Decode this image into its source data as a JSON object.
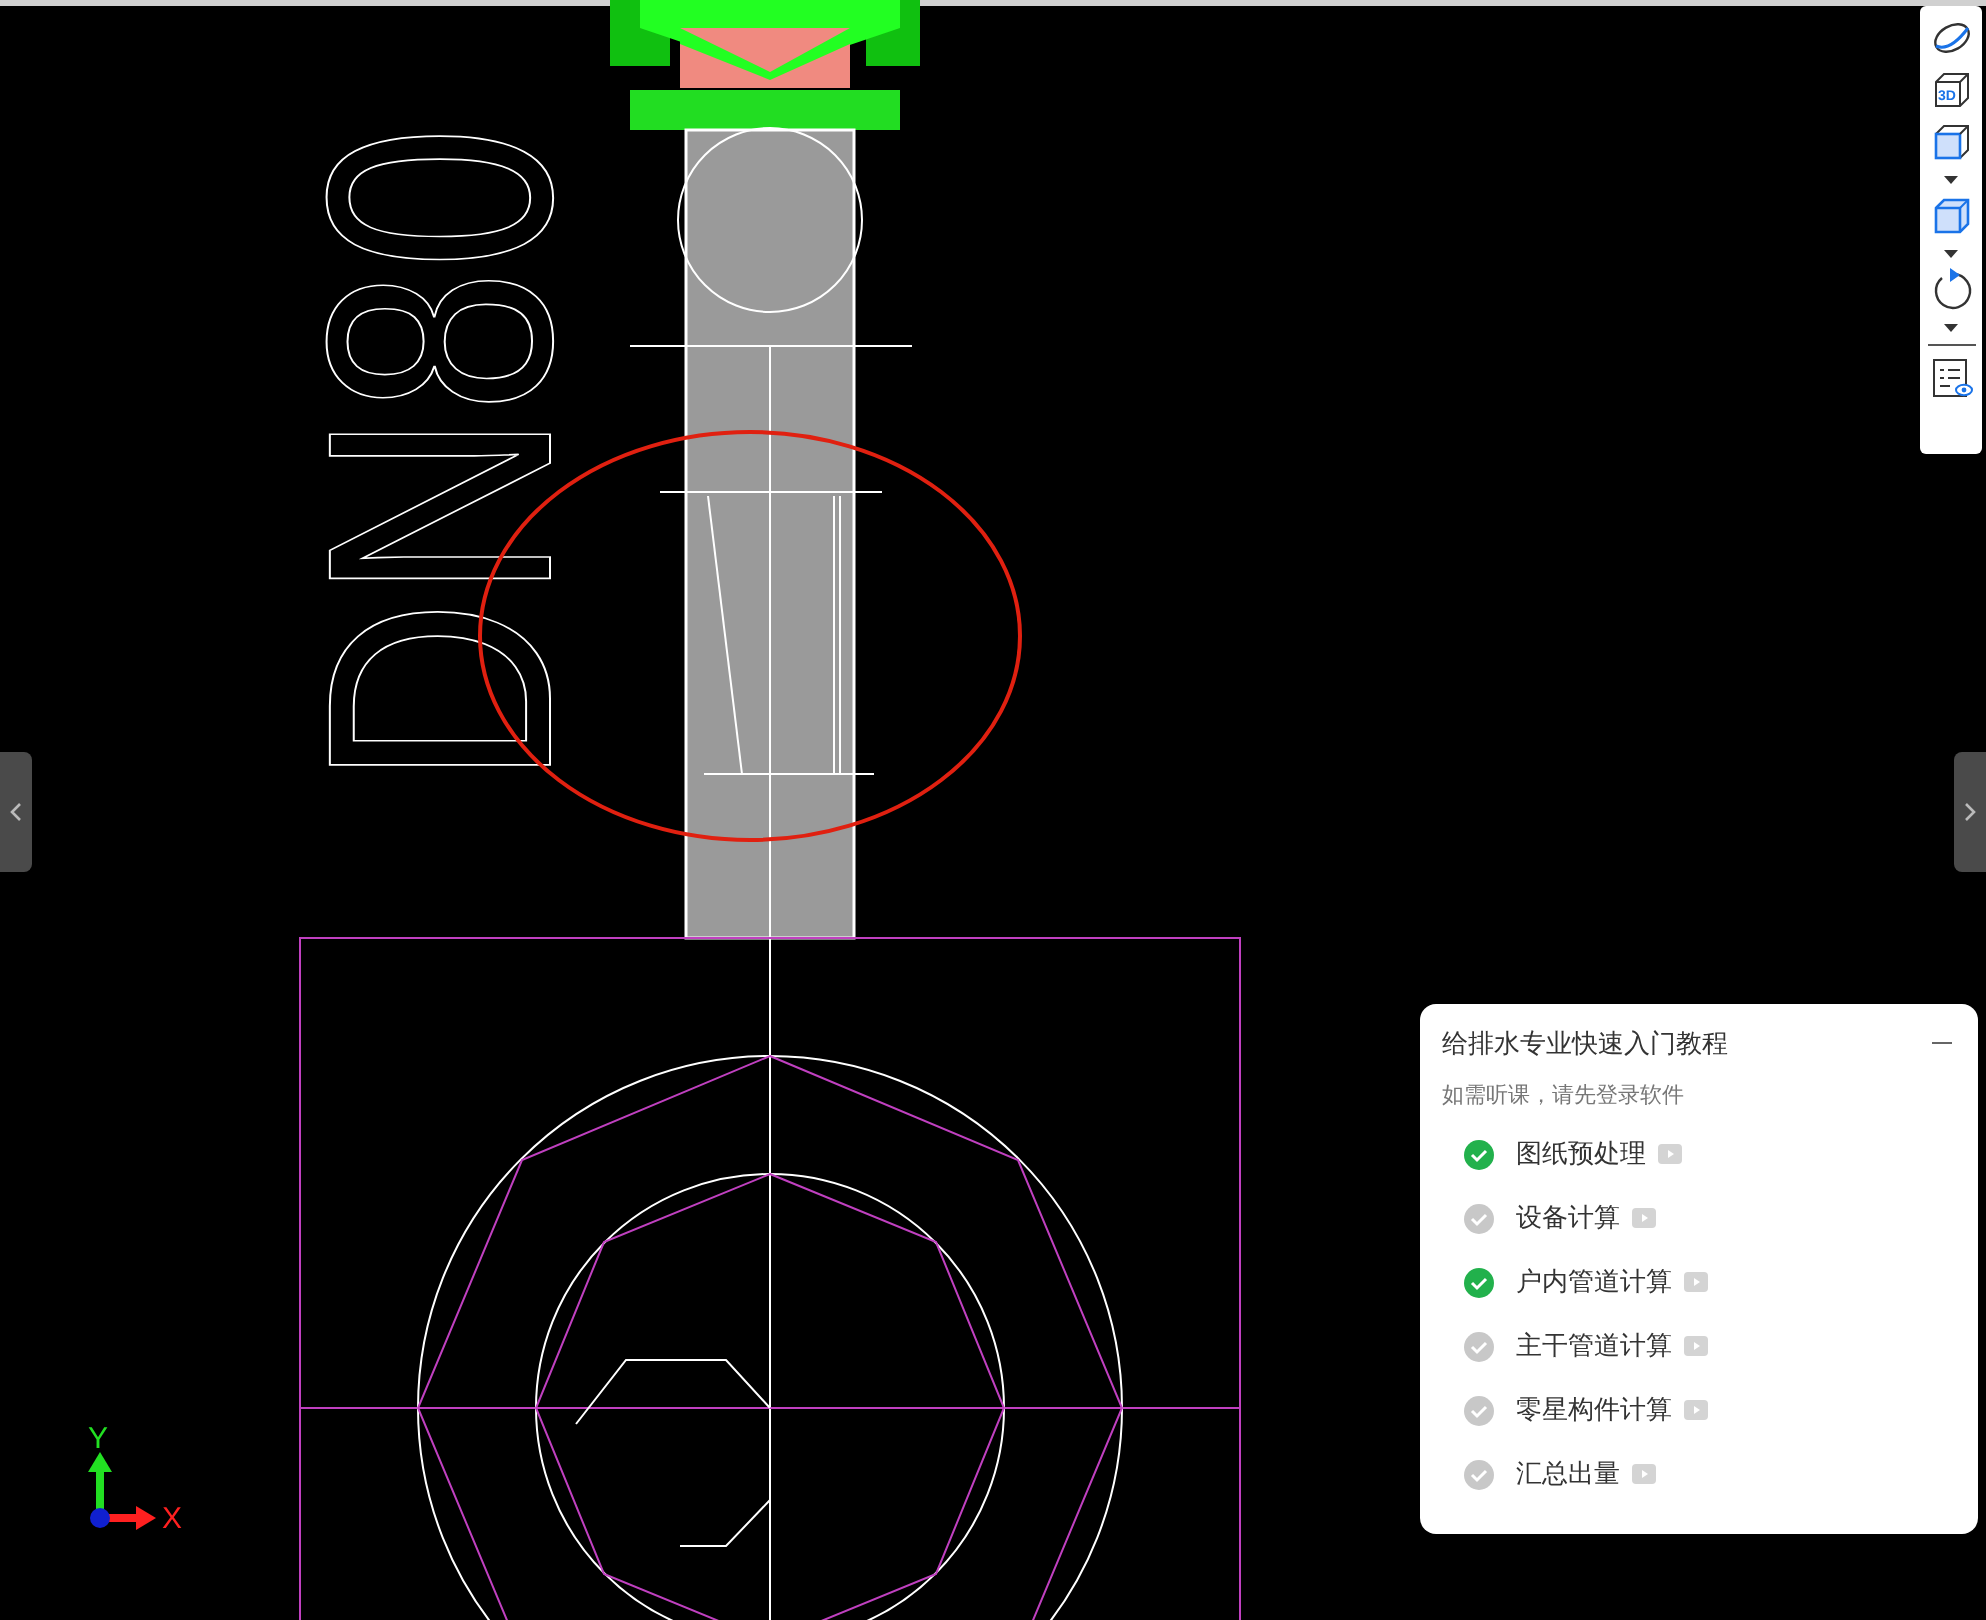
{
  "drawing": {
    "cad_text": "DN80"
  },
  "axis": {
    "y_label": "Y",
    "x_label": "X"
  },
  "toolbar": {
    "items": [
      {
        "kind": "orbit"
      },
      {
        "kind": "view3d",
        "label": "3D"
      },
      {
        "kind": "cube",
        "dropdown": true
      },
      {
        "kind": "cube-front",
        "dropdown": true
      },
      {
        "kind": "rotate",
        "dropdown": true
      },
      {
        "kind": "properties"
      }
    ]
  },
  "tutorial": {
    "title": "给排水专业快速入门教程",
    "subtitle": "如需听课，请先登录软件",
    "lessons": [
      {
        "label": "图纸预处理",
        "done": true
      },
      {
        "label": "设备计算",
        "done": false
      },
      {
        "label": "户内管道计算",
        "done": true
      },
      {
        "label": "主干管道计算",
        "done": false
      },
      {
        "label": "零星构件计算",
        "done": false
      },
      {
        "label": "汇总出量",
        "done": false
      }
    ]
  }
}
